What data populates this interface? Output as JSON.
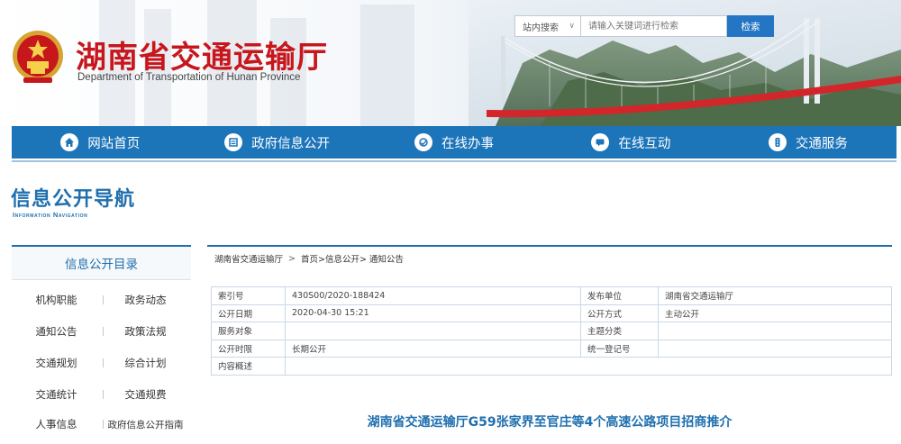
{
  "header": {
    "title": "湖南省交通运输厅",
    "subtitle": "Department of Transportation of Hunan Province",
    "emblem_icon": "national-emblem-icon",
    "brand_color": "#c8161d"
  },
  "search": {
    "scope_label": "站内搜索",
    "placeholder": "请输入关键词进行检索",
    "button_label": "检索"
  },
  "nav": {
    "color": "#1c74b9",
    "items": [
      {
        "label": "网站首页",
        "icon": "home-icon"
      },
      {
        "label": "政府信息公开",
        "icon": "document-icon"
      },
      {
        "label": "在线办事",
        "icon": "service-icon"
      },
      {
        "label": "在线互动",
        "icon": "chat-icon"
      },
      {
        "label": "交通服务",
        "icon": "traffic-light-icon"
      }
    ]
  },
  "section": {
    "title": "信息公开导航",
    "subtitle": "Information Navigation"
  },
  "sidebar": {
    "heading": "信息公开目录",
    "rows": [
      [
        "机构职能",
        "政务动态"
      ],
      [
        "通知公告",
        "政策法规"
      ],
      [
        "交通规划",
        "综合计划"
      ],
      [
        "交通统计",
        "交通规费"
      ],
      [
        "人事信息",
        "政府信息公开指南"
      ]
    ]
  },
  "breadcrumb": {
    "root": "湖南省交通运输厅",
    "separator": ">",
    "path": "首页>信息公开> 通知公告"
  },
  "meta": {
    "rows": [
      {
        "k1": "索引号",
        "v1": "430S00/2020-188424",
        "k2": "发布单位",
        "v2": "湖南省交通运输厅"
      },
      {
        "k1": "公开日期",
        "v1": "2020-04-30 15:21",
        "k2": "公开方式",
        "v2": "主动公开"
      },
      {
        "k1": "服务对象",
        "v1": "",
        "k2": "主题分类",
        "v2": ""
      },
      {
        "k1": "公开时限",
        "v1": "长期公开",
        "k2": "统一登记号",
        "v2": ""
      },
      {
        "k1": "内容概述",
        "v1": "",
        "k2": "",
        "v2": ""
      }
    ]
  },
  "document": {
    "title": "湖南省交通运输厅G59张家界至官庄等4个高速公路项目招商推介"
  }
}
